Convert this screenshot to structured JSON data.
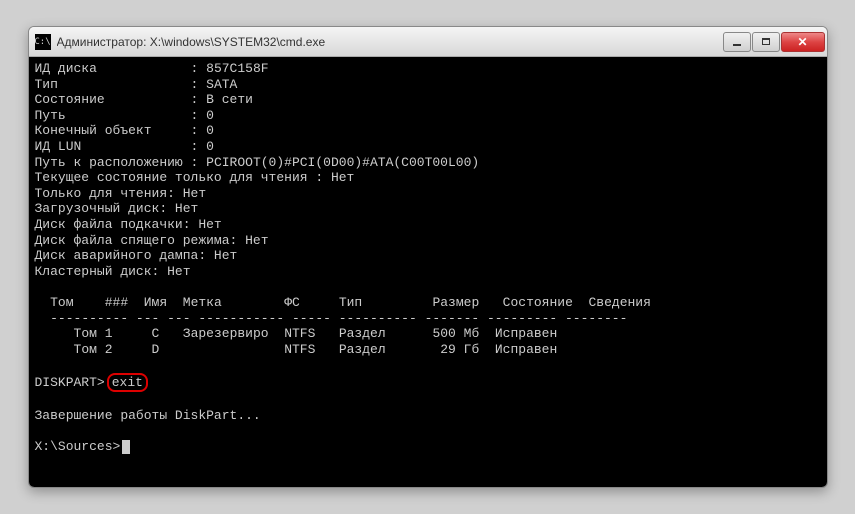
{
  "window": {
    "title": "Администратор: X:\\windows\\SYSTEM32\\cmd.exe"
  },
  "disk_info": {
    "id_label": "ИД диска",
    "id_value": "857C158F",
    "type_label": "Тип",
    "type_value": "SATA",
    "state_label": "Состояние",
    "state_value": "В сети",
    "path_label": "Путь",
    "path_value": "0",
    "target_label": "Конечный объект",
    "target_value": "0",
    "lun_label": "ИД LUN",
    "lun_value": "0",
    "location_label": "Путь к расположению",
    "location_value": "PCIROOT(0)#PCI(0D00)#ATA(C00T00L00)",
    "readonly_current": "Текущее состояние только для чтения : Нет",
    "readonly_only": "Только для чтения: Нет",
    "boot_disk": "Загрузочный диск: Нет",
    "pagefile_disk": "Диск файла подкачки: Нет",
    "hibernate_disk": "Диск файла спящего режима: Нет",
    "crashdump_disk": "Диск аварийного дампа: Нет",
    "cluster_disk": "Кластерный диск: Нет"
  },
  "volume_table": {
    "headers": {
      "tom": "Том",
      "num": "###",
      "name": "Имя",
      "label": "Метка",
      "fs": "ФС",
      "type": "Тип",
      "size": "Размер",
      "state": "Состояние",
      "info": "Сведения"
    },
    "separator": "---------- --- --- ----------- ----- ---------- ------- --------- --------",
    "rows": [
      {
        "tom": "Том 1",
        "name": "C",
        "label": "Зарезервиро",
        "fs": "NTFS",
        "type": "Раздел",
        "size": "500 Мб",
        "state": "Исправен"
      },
      {
        "tom": "Том 2",
        "name": "D",
        "label": "",
        "fs": "NTFS",
        "type": "Раздел",
        "size": "29 Гб",
        "state": "Исправен"
      }
    ]
  },
  "prompt": {
    "diskpart_prompt": "DISKPART>",
    "command": "exit",
    "exit_message": "Завершение работы DiskPart...",
    "sources_prompt": "X:\\Sources>"
  }
}
